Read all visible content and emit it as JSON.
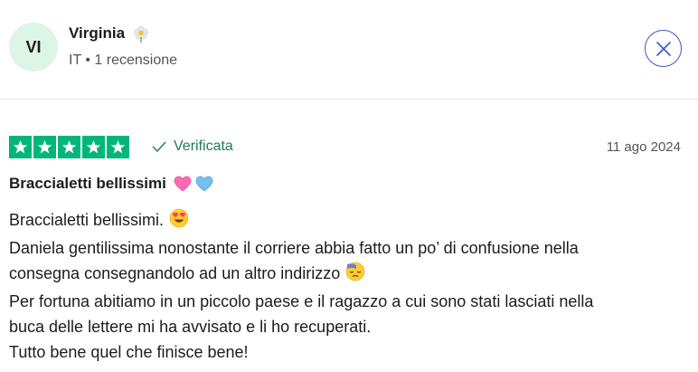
{
  "reviewer": {
    "initials": "VI",
    "name": "Virginia",
    "meta": "IT • 1 recensione",
    "badge_icon": "flower-icon"
  },
  "close_icon": "close-icon",
  "review": {
    "rating": 5,
    "max_rating": 5,
    "star_color": "#00b67a",
    "verified_label": "Verificata",
    "date": "11 ago 2024",
    "title": "Braccialetti bellissimi",
    "title_emojis": [
      "pink-heart-icon",
      "blue-heart-icon"
    ],
    "body_lines": [
      "Braccialetti bellissimi.",
      "Daniela gentilissima nonostante il corriere abbia fatto un po’ di confusione nella",
      "consegna consegnandolo ad un altro indirizzo",
      "Per fortuna abitiamo in un piccolo paese e il ragazzo a cui sono stati lasciati nella",
      "buca delle lettere mi ha avvisato e li ho recuperati.",
      "Tutto bene quel che finisce bene!"
    ]
  },
  "colors": {
    "accent_blue": "#3c57bc",
    "avatar_bg": "#dcf5e5",
    "verified_green": "#1f7a4d"
  }
}
